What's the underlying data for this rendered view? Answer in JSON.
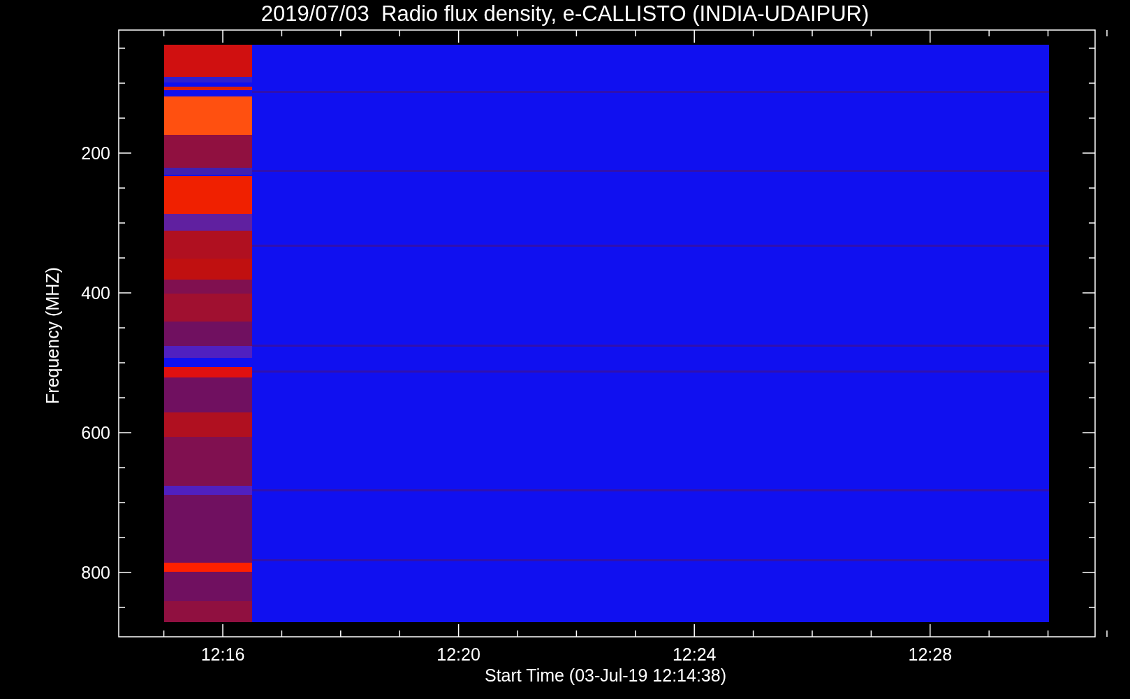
{
  "title": "2019/07/03  Radio flux density, e-CALLISTO (INDIA-UDAIPUR)",
  "y_axis": {
    "label": "Frequency (MHZ)",
    "ticks": [
      "200",
      "400",
      "600",
      "800"
    ]
  },
  "x_axis": {
    "label": "Start Time (03-Jul-19 12:14:38)",
    "ticks": [
      "12:16",
      "12:20",
      "12:24",
      "12:28"
    ]
  }
}
